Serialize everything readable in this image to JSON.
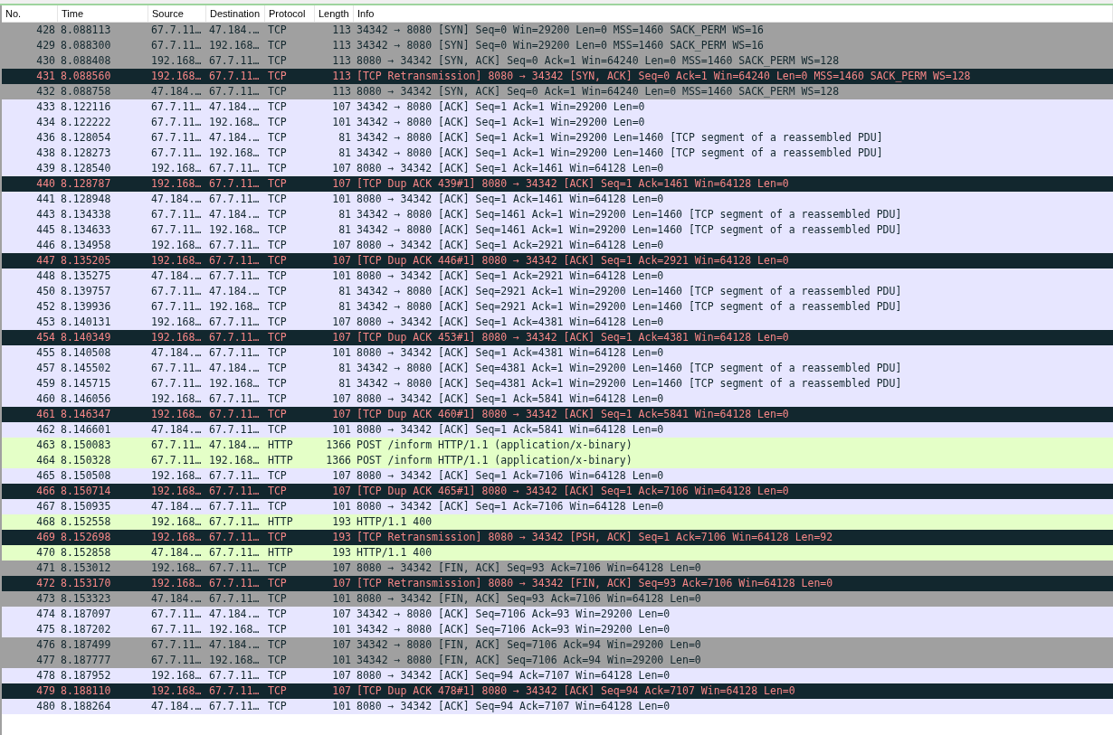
{
  "columns": [
    "No.",
    "Time",
    "Source",
    "Destination",
    "Protocol",
    "Length",
    "Info"
  ],
  "rows": [
    {
      "kind": "flag",
      "no": "428",
      "time": "8.088113",
      "source": "67.7.11…",
      "destination": "47.184.…",
      "protocol": "TCP",
      "length": "113",
      "info": "34342 → 8080 [SYN] Seq=0 Win=29200 Len=0 MSS=1460 SACK_PERM WS=16"
    },
    {
      "kind": "flag",
      "no": "429",
      "time": "8.088300",
      "source": "67.7.11…",
      "destination": "192.168…",
      "protocol": "TCP",
      "length": "113",
      "info": "34342 → 8080 [SYN] Seq=0 Win=29200 Len=0 MSS=1460 SACK_PERM WS=16"
    },
    {
      "kind": "flag",
      "no": "430",
      "time": "8.088408",
      "source": "192.168…",
      "destination": "67.7.11…",
      "protocol": "TCP",
      "length": "113",
      "info": "8080 → 34342 [SYN, ACK] Seq=0 Ack=1 Win=64240 Len=0 MSS=1460 SACK_PERM WS=128"
    },
    {
      "kind": "bad",
      "no": "431",
      "time": "8.088560",
      "source": "192.168…",
      "destination": "67.7.11…",
      "protocol": "TCP",
      "length": "113",
      "info": "[TCP Retransmission] 8080 → 34342 [SYN, ACK] Seq=0 Ack=1 Win=64240 Len=0 MSS=1460 SACK_PERM WS=128"
    },
    {
      "kind": "flag",
      "no": "432",
      "time": "8.088758",
      "source": "47.184.…",
      "destination": "67.7.11…",
      "protocol": "TCP",
      "length": "113",
      "info": "8080 → 34342 [SYN, ACK] Seq=0 Ack=1 Win=64240 Len=0 MSS=1460 SACK_PERM WS=128"
    },
    {
      "kind": "tcp",
      "no": "433",
      "time": "8.122116",
      "source": "67.7.11…",
      "destination": "47.184.…",
      "protocol": "TCP",
      "length": "107",
      "info": "34342 → 8080 [ACK] Seq=1 Ack=1 Win=29200 Len=0"
    },
    {
      "kind": "tcp",
      "no": "434",
      "time": "8.122222",
      "source": "67.7.11…",
      "destination": "192.168…",
      "protocol": "TCP",
      "length": "101",
      "info": "34342 → 8080 [ACK] Seq=1 Ack=1 Win=29200 Len=0"
    },
    {
      "kind": "tcp",
      "no": "436",
      "time": "8.128054",
      "source": "67.7.11…",
      "destination": "47.184.…",
      "protocol": "TCP",
      "length": "81",
      "info": "34342 → 8080 [ACK] Seq=1 Ack=1 Win=29200 Len=1460 [TCP segment of a reassembled PDU]"
    },
    {
      "kind": "tcp",
      "no": "438",
      "time": "8.128273",
      "source": "67.7.11…",
      "destination": "192.168…",
      "protocol": "TCP",
      "length": "81",
      "info": "34342 → 8080 [ACK] Seq=1 Ack=1 Win=29200 Len=1460 [TCP segment of a reassembled PDU]"
    },
    {
      "kind": "tcp",
      "no": "439",
      "time": "8.128540",
      "source": "192.168…",
      "destination": "67.7.11…",
      "protocol": "TCP",
      "length": "107",
      "info": "8080 → 34342 [ACK] Seq=1 Ack=1461 Win=64128 Len=0"
    },
    {
      "kind": "bad",
      "no": "440",
      "time": "8.128787",
      "source": "192.168…",
      "destination": "67.7.11…",
      "protocol": "TCP",
      "length": "107",
      "info": "[TCP Dup ACK 439#1] 8080 → 34342 [ACK] Seq=1 Ack=1461 Win=64128 Len=0"
    },
    {
      "kind": "tcp",
      "no": "441",
      "time": "8.128948",
      "source": "47.184.…",
      "destination": "67.7.11…",
      "protocol": "TCP",
      "length": "101",
      "info": "8080 → 34342 [ACK] Seq=1 Ack=1461 Win=64128 Len=0"
    },
    {
      "kind": "tcp",
      "no": "443",
      "time": "8.134338",
      "source": "67.7.11…",
      "destination": "47.184.…",
      "protocol": "TCP",
      "length": "81",
      "info": "34342 → 8080 [ACK] Seq=1461 Ack=1 Win=29200 Len=1460 [TCP segment of a reassembled PDU]"
    },
    {
      "kind": "tcp",
      "no": "445",
      "time": "8.134633",
      "source": "67.7.11…",
      "destination": "192.168…",
      "protocol": "TCP",
      "length": "81",
      "info": "34342 → 8080 [ACK] Seq=1461 Ack=1 Win=29200 Len=1460 [TCP segment of a reassembled PDU]"
    },
    {
      "kind": "tcp",
      "no": "446",
      "time": "8.134958",
      "source": "192.168…",
      "destination": "67.7.11…",
      "protocol": "TCP",
      "length": "107",
      "info": "8080 → 34342 [ACK] Seq=1 Ack=2921 Win=64128 Len=0"
    },
    {
      "kind": "bad",
      "no": "447",
      "time": "8.135205",
      "source": "192.168…",
      "destination": "67.7.11…",
      "protocol": "TCP",
      "length": "107",
      "info": "[TCP Dup ACK 446#1] 8080 → 34342 [ACK] Seq=1 Ack=2921 Win=64128 Len=0"
    },
    {
      "kind": "tcp",
      "no": "448",
      "time": "8.135275",
      "source": "47.184.…",
      "destination": "67.7.11…",
      "protocol": "TCP",
      "length": "101",
      "info": "8080 → 34342 [ACK] Seq=1 Ack=2921 Win=64128 Len=0"
    },
    {
      "kind": "tcp",
      "no": "450",
      "time": "8.139757",
      "source": "67.7.11…",
      "destination": "47.184.…",
      "protocol": "TCP",
      "length": "81",
      "info": "34342 → 8080 [ACK] Seq=2921 Ack=1 Win=29200 Len=1460 [TCP segment of a reassembled PDU]"
    },
    {
      "kind": "tcp",
      "no": "452",
      "time": "8.139936",
      "source": "67.7.11…",
      "destination": "192.168…",
      "protocol": "TCP",
      "length": "81",
      "info": "34342 → 8080 [ACK] Seq=2921 Ack=1 Win=29200 Len=1460 [TCP segment of a reassembled PDU]"
    },
    {
      "kind": "tcp",
      "no": "453",
      "time": "8.140131",
      "source": "192.168…",
      "destination": "67.7.11…",
      "protocol": "TCP",
      "length": "107",
      "info": "8080 → 34342 [ACK] Seq=1 Ack=4381 Win=64128 Len=0"
    },
    {
      "kind": "bad",
      "no": "454",
      "time": "8.140349",
      "source": "192.168…",
      "destination": "67.7.11…",
      "protocol": "TCP",
      "length": "107",
      "info": "[TCP Dup ACK 453#1] 8080 → 34342 [ACK] Seq=1 Ack=4381 Win=64128 Len=0"
    },
    {
      "kind": "tcp",
      "no": "455",
      "time": "8.140508",
      "source": "47.184.…",
      "destination": "67.7.11…",
      "protocol": "TCP",
      "length": "101",
      "info": "8080 → 34342 [ACK] Seq=1 Ack=4381 Win=64128 Len=0"
    },
    {
      "kind": "tcp",
      "no": "457",
      "time": "8.145502",
      "source": "67.7.11…",
      "destination": "47.184.…",
      "protocol": "TCP",
      "length": "81",
      "info": "34342 → 8080 [ACK] Seq=4381 Ack=1 Win=29200 Len=1460 [TCP segment of a reassembled PDU]"
    },
    {
      "kind": "tcp",
      "no": "459",
      "time": "8.145715",
      "source": "67.7.11…",
      "destination": "192.168…",
      "protocol": "TCP",
      "length": "81",
      "info": "34342 → 8080 [ACK] Seq=4381 Ack=1 Win=29200 Len=1460 [TCP segment of a reassembled PDU]"
    },
    {
      "kind": "tcp",
      "no": "460",
      "time": "8.146056",
      "source": "192.168…",
      "destination": "67.7.11…",
      "protocol": "TCP",
      "length": "107",
      "info": "8080 → 34342 [ACK] Seq=1 Ack=5841 Win=64128 Len=0"
    },
    {
      "kind": "bad",
      "no": "461",
      "time": "8.146347",
      "source": "192.168…",
      "destination": "67.7.11…",
      "protocol": "TCP",
      "length": "107",
      "info": "[TCP Dup ACK 460#1] 8080 → 34342 [ACK] Seq=1 Ack=5841 Win=64128 Len=0"
    },
    {
      "kind": "tcp",
      "no": "462",
      "time": "8.146601",
      "source": "47.184.…",
      "destination": "67.7.11…",
      "protocol": "TCP",
      "length": "101",
      "info": "8080 → 34342 [ACK] Seq=1 Ack=5841 Win=64128 Len=0"
    },
    {
      "kind": "http",
      "no": "463",
      "time": "8.150083",
      "source": "67.7.11…",
      "destination": "47.184.…",
      "protocol": "HTTP",
      "length": "1366",
      "info": "POST /inform HTTP/1.1  (application/x-binary)"
    },
    {
      "kind": "http",
      "no": "464",
      "time": "8.150328",
      "source": "67.7.11…",
      "destination": "192.168…",
      "protocol": "HTTP",
      "length": "1366",
      "info": "POST /inform HTTP/1.1  (application/x-binary)"
    },
    {
      "kind": "tcp",
      "no": "465",
      "time": "8.150508",
      "source": "192.168…",
      "destination": "67.7.11…",
      "protocol": "TCP",
      "length": "107",
      "info": "8080 → 34342 [ACK] Seq=1 Ack=7106 Win=64128 Len=0"
    },
    {
      "kind": "bad",
      "no": "466",
      "time": "8.150714",
      "source": "192.168…",
      "destination": "67.7.11…",
      "protocol": "TCP",
      "length": "107",
      "info": "[TCP Dup ACK 465#1] 8080 → 34342 [ACK] Seq=1 Ack=7106 Win=64128 Len=0"
    },
    {
      "kind": "tcp",
      "no": "467",
      "time": "8.150935",
      "source": "47.184.…",
      "destination": "67.7.11…",
      "protocol": "TCP",
      "length": "101",
      "info": "8080 → 34342 [ACK] Seq=1 Ack=7106 Win=64128 Len=0"
    },
    {
      "kind": "http",
      "no": "468",
      "time": "8.152558",
      "source": "192.168…",
      "destination": "67.7.11…",
      "protocol": "HTTP",
      "length": "193",
      "info": "HTTP/1.1 400"
    },
    {
      "kind": "bad",
      "no": "469",
      "time": "8.152698",
      "source": "192.168…",
      "destination": "67.7.11…",
      "protocol": "TCP",
      "length": "193",
      "info": "[TCP Retransmission] 8080 → 34342 [PSH, ACK] Seq=1 Ack=7106 Win=64128 Len=92"
    },
    {
      "kind": "http",
      "no": "470",
      "time": "8.152858",
      "source": "47.184.…",
      "destination": "67.7.11…",
      "protocol": "HTTP",
      "length": "193",
      "info": "HTTP/1.1 400"
    },
    {
      "kind": "flag",
      "no": "471",
      "time": "8.153012",
      "source": "192.168…",
      "destination": "67.7.11…",
      "protocol": "TCP",
      "length": "107",
      "info": "8080 → 34342 [FIN, ACK] Seq=93 Ack=7106 Win=64128 Len=0"
    },
    {
      "kind": "bad",
      "no": "472",
      "time": "8.153170",
      "source": "192.168…",
      "destination": "67.7.11…",
      "protocol": "TCP",
      "length": "107",
      "info": "[TCP Retransmission] 8080 → 34342 [FIN, ACK] Seq=93 Ack=7106 Win=64128 Len=0"
    },
    {
      "kind": "flag",
      "no": "473",
      "time": "8.153323",
      "source": "47.184.…",
      "destination": "67.7.11…",
      "protocol": "TCP",
      "length": "101",
      "info": "8080 → 34342 [FIN, ACK] Seq=93 Ack=7106 Win=64128 Len=0"
    },
    {
      "kind": "tcp",
      "no": "474",
      "time": "8.187097",
      "source": "67.7.11…",
      "destination": "47.184.…",
      "protocol": "TCP",
      "length": "107",
      "info": "34342 → 8080 [ACK] Seq=7106 Ack=93 Win=29200 Len=0"
    },
    {
      "kind": "tcp",
      "no": "475",
      "time": "8.187202",
      "source": "67.7.11…",
      "destination": "192.168…",
      "protocol": "TCP",
      "length": "101",
      "info": "34342 → 8080 [ACK] Seq=7106 Ack=93 Win=29200 Len=0"
    },
    {
      "kind": "flag",
      "no": "476",
      "time": "8.187499",
      "source": "67.7.11…",
      "destination": "47.184.…",
      "protocol": "TCP",
      "length": "107",
      "info": "34342 → 8080 [FIN, ACK] Seq=7106 Ack=94 Win=29200 Len=0"
    },
    {
      "kind": "flag",
      "no": "477",
      "time": "8.187777",
      "source": "67.7.11…",
      "destination": "192.168…",
      "protocol": "TCP",
      "length": "101",
      "info": "34342 → 8080 [FIN, ACK] Seq=7106 Ack=94 Win=29200 Len=0"
    },
    {
      "kind": "tcp",
      "no": "478",
      "time": "8.187952",
      "source": "192.168…",
      "destination": "67.7.11…",
      "protocol": "TCP",
      "length": "107",
      "info": "8080 → 34342 [ACK] Seq=94 Ack=7107 Win=64128 Len=0"
    },
    {
      "kind": "bad",
      "no": "479",
      "time": "8.188110",
      "source": "192.168…",
      "destination": "67.7.11…",
      "protocol": "TCP",
      "length": "107",
      "info": "[TCP Dup ACK 478#1] 8080 → 34342 [ACK] Seq=94 Ack=7107 Win=64128 Len=0"
    },
    {
      "kind": "tcp",
      "no": "480",
      "time": "8.188264",
      "source": "47.184.…",
      "destination": "67.7.11…",
      "protocol": "TCP",
      "length": "101",
      "info": "8080 → 34342 [ACK] Seq=94 Ack=7107 Win=64128 Len=0"
    }
  ]
}
